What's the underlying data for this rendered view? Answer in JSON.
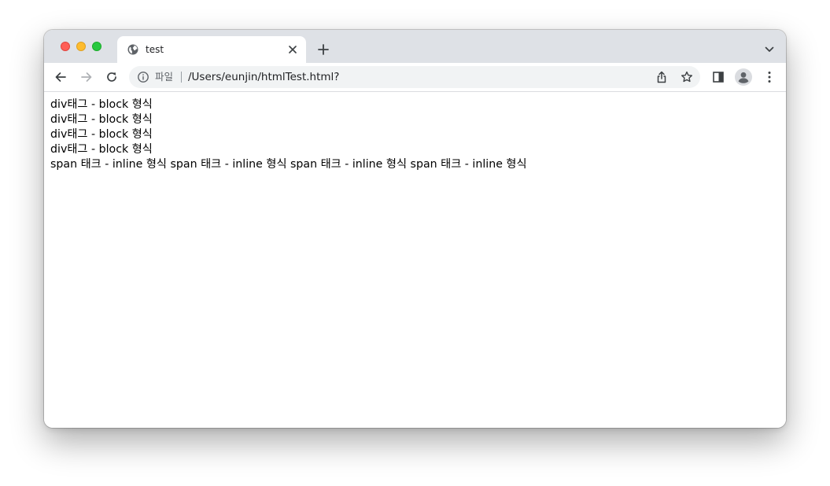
{
  "window": {
    "accent_color": "#dee1e6",
    "controls": {
      "close_color": "#ff5f57",
      "minimize_color": "#febc2e",
      "zoom_color": "#28c840"
    }
  },
  "tabs": [
    {
      "title": "test",
      "icon": "globe-icon",
      "active": true
    }
  ],
  "toolbar": {
    "back_icon": "arrow-left-icon",
    "forward_icon": "arrow-right-icon",
    "reload_icon": "reload-icon",
    "scheme_label": "파일",
    "url": "/Users/eunjin/htmlTest.html?",
    "share_icon": "share-icon",
    "bookmark_icon": "star-icon",
    "sidepanel_icon": "side-panel-icon",
    "profile_icon": "avatar-icon",
    "menu_icon": "kebab-menu-icon"
  },
  "page": {
    "div_lines": [
      "div태그 - block 형식",
      "div태그 - block 형식",
      "div태그 - block 형식",
      "div태그 - block 형식"
    ],
    "span_items": [
      "span 태크 - inline 형식",
      "span 태크 - inline 형식",
      "span 태크 - inline 형식",
      "span 태크 - inline 형식"
    ]
  }
}
